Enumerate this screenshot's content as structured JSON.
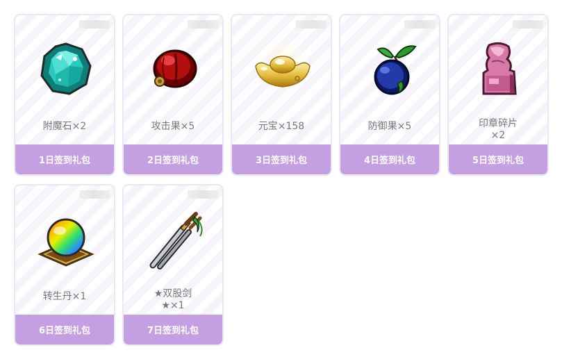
{
  "rewards": [
    {
      "name": "附魔石×2",
      "name_line2": "",
      "label": "1日签到礼包",
      "icon": "enchant-stone-icon"
    },
    {
      "name": "攻击果×5",
      "name_line2": "",
      "label": "2日签到礼包",
      "icon": "attack-fruit-icon"
    },
    {
      "name": "元宝×158",
      "name_line2": "",
      "label": "3日签到礼包",
      "icon": "gold-ingot-icon"
    },
    {
      "name": "防御果×5",
      "name_line2": "",
      "label": "4日签到礼包",
      "icon": "defense-fruit-icon"
    },
    {
      "name": "印章碎片",
      "name_line2": "×2",
      "label": "5日签到礼包",
      "icon": "seal-fragment-icon"
    },
    {
      "name": "转生丹×1",
      "name_line2": "",
      "label": "6日签到礼包",
      "icon": "rebirth-pill-icon"
    },
    {
      "name": "★双股剑",
      "name_line2": "★×1",
      "label": "7日签到礼包",
      "icon": "twin-swords-icon"
    }
  ],
  "colors": {
    "footer": "#c4a0e2",
    "card_border": "#ece6f6",
    "name_text": "#777777"
  }
}
